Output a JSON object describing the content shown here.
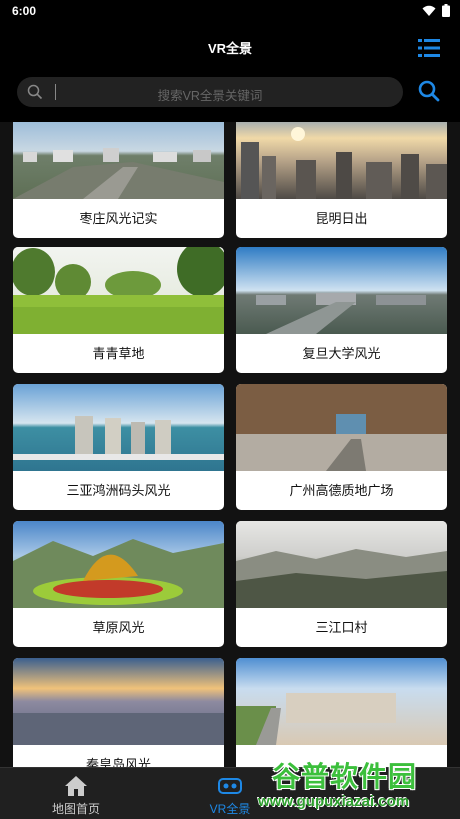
{
  "status_bar": {
    "time": "6:00"
  },
  "header": {
    "title": "VR全景",
    "menu_icon": "list-menu-icon"
  },
  "search": {
    "placeholder": "搜索VR全景关键词",
    "icon": "search-icon"
  },
  "colors": {
    "accent": "#1e88e5",
    "background": "#000000",
    "grid_bg": "#121212",
    "card_bg": "#ffffff"
  },
  "panoramas": [
    {
      "title": "枣庄风光记实"
    },
    {
      "title": "昆明日出"
    },
    {
      "title": "青青草地"
    },
    {
      "title": "复旦大学风光"
    },
    {
      "title": "三亚鸿洲码头风光"
    },
    {
      "title": "广州高德质地广场"
    },
    {
      "title": "草原风光"
    },
    {
      "title": "三江口村"
    },
    {
      "title": "秦皇岛风光"
    },
    {
      "title": ""
    }
  ],
  "tabbar": {
    "tabs": [
      {
        "label": "地图首页",
        "icon": "home-icon",
        "active": false
      },
      {
        "label": "VR全景",
        "icon": "vr-glasses-icon",
        "active": true
      }
    ]
  },
  "watermark": {
    "title": "谷普软件园",
    "url": "www.gupuxiazai.com"
  }
}
